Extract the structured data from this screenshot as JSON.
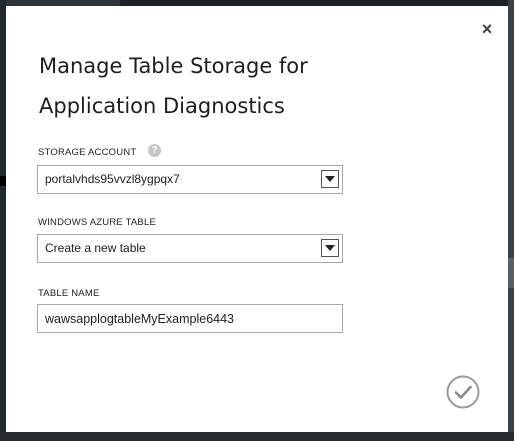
{
  "dialog": {
    "title_line1": "Manage Table Storage for",
    "title_line2": "Application Diagnostics",
    "close_glyph": "×"
  },
  "fields": {
    "storage_account": {
      "label": "STORAGE ACCOUNT",
      "value": "portalvhds95vvzl8ygpqx7",
      "help_glyph": "?"
    },
    "azure_table": {
      "label": "WINDOWS AZURE TABLE",
      "value": "Create a new table"
    },
    "table_name": {
      "label": "TABLE NAME",
      "value": "wawsapplogtableMyExample6443"
    }
  },
  "icons": {
    "close": "close-icon",
    "help": "help-icon",
    "dropdown": "chevron-down-icon",
    "confirm": "checkmark-icon"
  },
  "colors": {
    "dialog_bg": "#ffffff",
    "backdrop": "#2f3538",
    "input_border": "#a9a9a9",
    "confirm_icon": "#8a8a8a"
  }
}
